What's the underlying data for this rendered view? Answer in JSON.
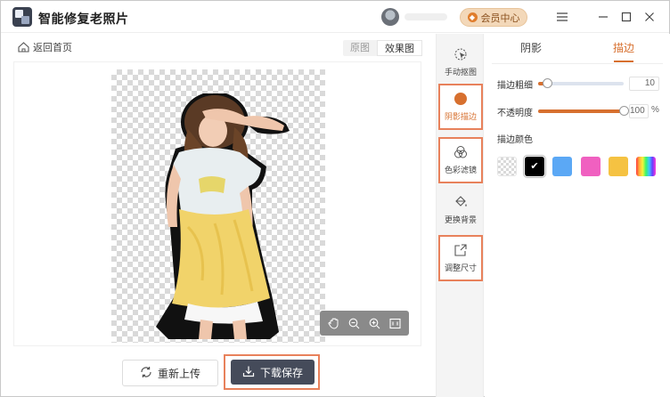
{
  "app": {
    "title": "智能修复老照片"
  },
  "user": {
    "vip_label": "会员中心"
  },
  "nav": {
    "back_label": "返回首页"
  },
  "view_toggle": {
    "original": "原图",
    "result": "效果图",
    "active": "result"
  },
  "actions": {
    "reupload": "重新上传",
    "download": "下载保存"
  },
  "tools": [
    {
      "label": "手动抠图",
      "icon": "cursor-select-icon",
      "highlighted": false
    },
    {
      "label": "阴影描边",
      "icon": "shadow-circle-icon",
      "highlighted": true
    },
    {
      "label": "色彩滤镜",
      "icon": "color-filter-icon",
      "highlighted": true
    },
    {
      "label": "更换背景",
      "icon": "paint-bucket-icon",
      "highlighted": false
    },
    {
      "label": "调整尺寸",
      "icon": "resize-icon",
      "highlighted": true
    }
  ],
  "panel": {
    "tabs": [
      {
        "label": "阴影"
      },
      {
        "label": "描边"
      }
    ],
    "active_tab": "描边",
    "stroke_width": {
      "label": "描边粗细",
      "value": "10",
      "fraction": 0.1
    },
    "opacity": {
      "label": "不透明度",
      "value": "100",
      "unit": "%",
      "fraction": 1.0
    },
    "stroke_color": {
      "label": "描边颜色",
      "swatches": [
        {
          "name": "transparent",
          "color": "transparent"
        },
        {
          "name": "black",
          "color": "#000000",
          "selected": true
        },
        {
          "name": "blue",
          "color": "#5ba8f5"
        },
        {
          "name": "pink",
          "color": "#f060c0"
        },
        {
          "name": "yellow",
          "color": "#f5c242"
        },
        {
          "name": "rainbow",
          "color": "gradient"
        }
      ]
    }
  },
  "colors": {
    "accent": "#d7702f",
    "highlight_border": "#e8815b",
    "dark_button": "#454b5a"
  }
}
